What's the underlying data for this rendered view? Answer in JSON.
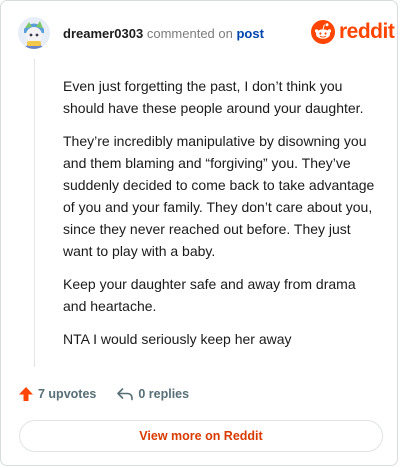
{
  "header": {
    "username": "dreamer0303",
    "action_text": "commented on",
    "target_link": "post",
    "brand_name": "reddit"
  },
  "colors": {
    "brand": "#ff4500",
    "link": "#0045ac",
    "upvote": "#ff4500"
  },
  "comment": {
    "paragraphs": [
      "Even just forgetting the past, I don’t think you should have these people around your daughter.",
      "They’re incredibly manipulative by disowning you and them blaming and “forgiving” you. They’ve suddenly decided to come back to take advantage of you and your family. They don’t care about you, since they never reached out before. They just want to play with a baby.",
      "Keep your daughter safe and away from drama and heartache.",
      "NTA I would seriously keep her away"
    ]
  },
  "footer": {
    "upvotes_label": "7 upvotes",
    "replies_label": "0 replies",
    "upvote_icon": "upvote-arrow-icon",
    "reply_icon": "reply-arrow-icon"
  },
  "cta": {
    "view_more_label": "View more on Reddit"
  }
}
